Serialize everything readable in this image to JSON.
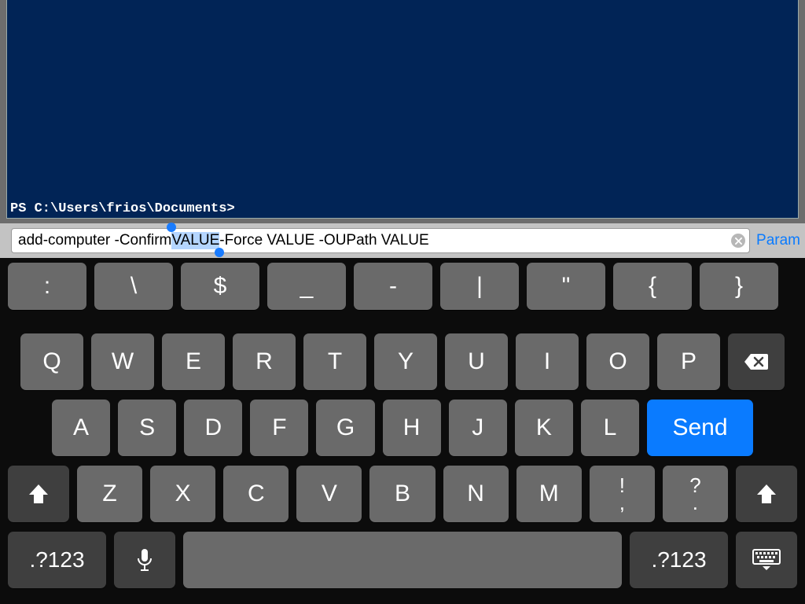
{
  "terminal": {
    "prompt": "PS C:\\Users\\frios\\Documents>"
  },
  "input": {
    "pre": "add-computer -Confirm ",
    "selected": "VALUE",
    "post": " -Force VALUE -OUPath VALUE",
    "param_link": "Param"
  },
  "keyboard": {
    "symbol_row": [
      ":",
      "\\",
      "$",
      "_",
      "-",
      "|",
      "\"",
      "{",
      "}"
    ],
    "row2": [
      "Q",
      "W",
      "E",
      "R",
      "T",
      "Y",
      "U",
      "I",
      "O",
      "P"
    ],
    "row3": [
      "A",
      "S",
      "D",
      "F",
      "G",
      "H",
      "J",
      "K",
      "L"
    ],
    "send": "Send",
    "row4": [
      "Z",
      "X",
      "C",
      "V",
      "B",
      "N",
      "M"
    ],
    "dual1": {
      "top": "!",
      "bot": ","
    },
    "dual2": {
      "top": "?",
      "bot": "."
    },
    "mode": ".?123"
  }
}
